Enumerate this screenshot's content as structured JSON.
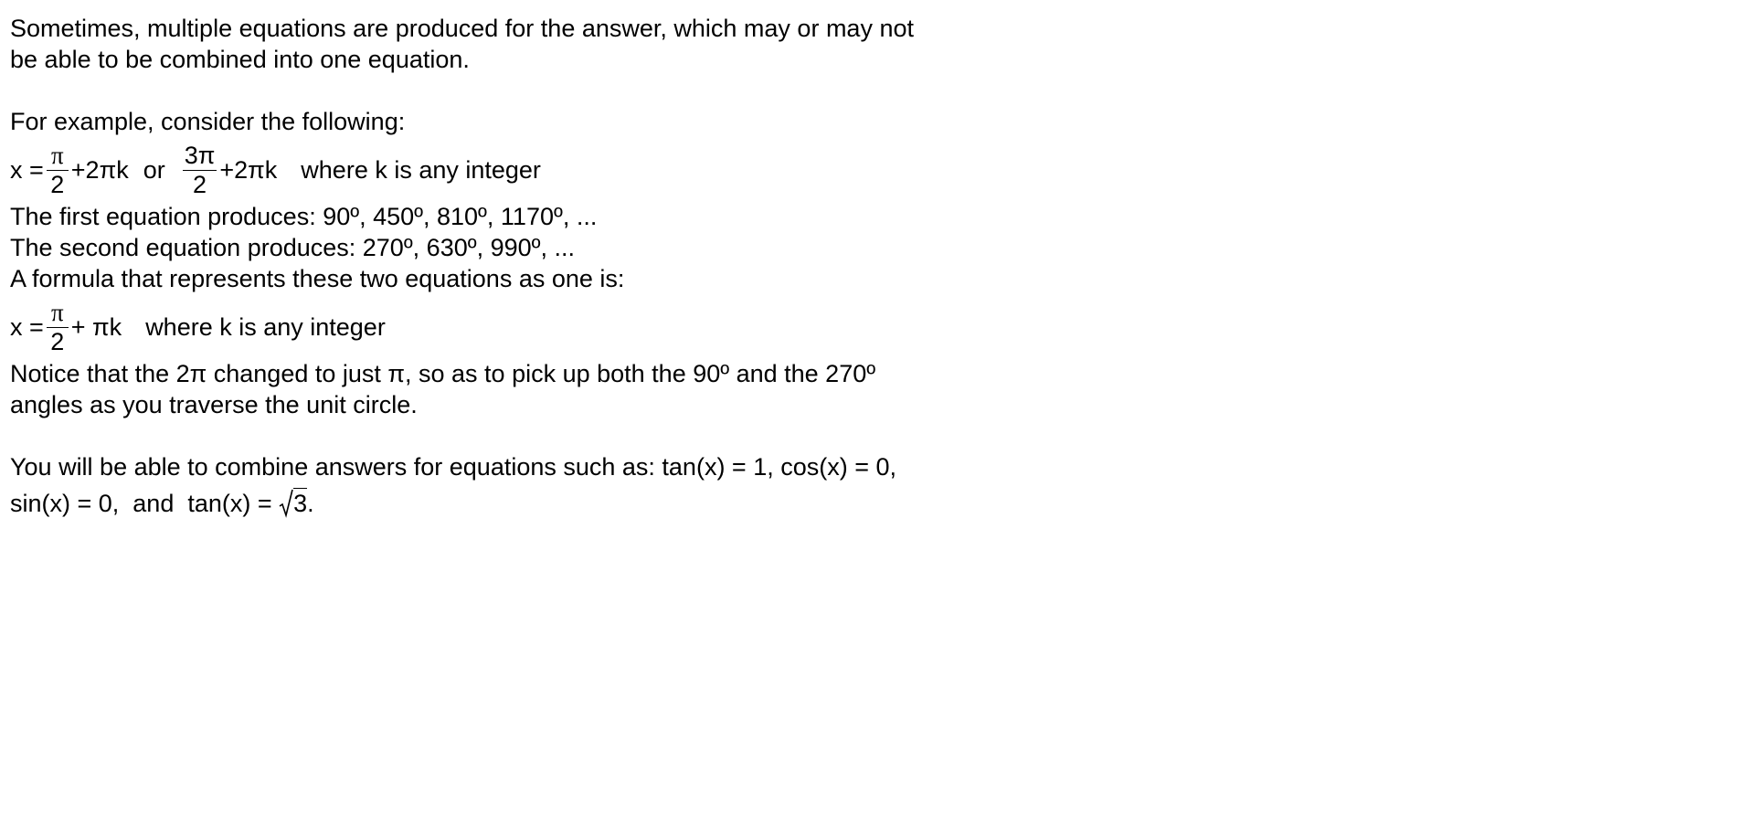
{
  "paragraph1": {
    "line1": "Sometimes, multiple equations are produced for the answer, which may or may not",
    "line2": "be able to be combined into one equation."
  },
  "example_intro": "For example, consider the following:",
  "equation1": {
    "lhs": "x =",
    "frac1_num": "π",
    "frac1_den": "2",
    "term1": "+2πk",
    "connector": "or",
    "frac2_num": "3π",
    "frac2_den": "2",
    "term2": "+2πk",
    "note": "where k is any integer"
  },
  "first_equation_line": "The first equation produces:  90º, 450º, 810º, 1170º, ...",
  "second_equation_line": "The second equation produces:  270º, 630º, 990º, ...",
  "formula_intro": "A formula that represents these two equations as one is:",
  "equation2": {
    "lhs": "x =",
    "frac_num": "π",
    "frac_den": "2",
    "term": "+ πk",
    "note": "where k is any integer"
  },
  "notice": {
    "line1": "Notice that the 2π changed to just π, so as to pick up both the 90º and the 270º",
    "line2": "angles as you traverse the unit circle."
  },
  "combine": {
    "line1": "You will be able to combine answers for equations such as:  tan(x) = 1,  cos(x) = 0,",
    "line2_prefix": "sin(x) = 0,  and  tan(x) = ",
    "line2_radicand": "3",
    "line2_suffix": "."
  }
}
